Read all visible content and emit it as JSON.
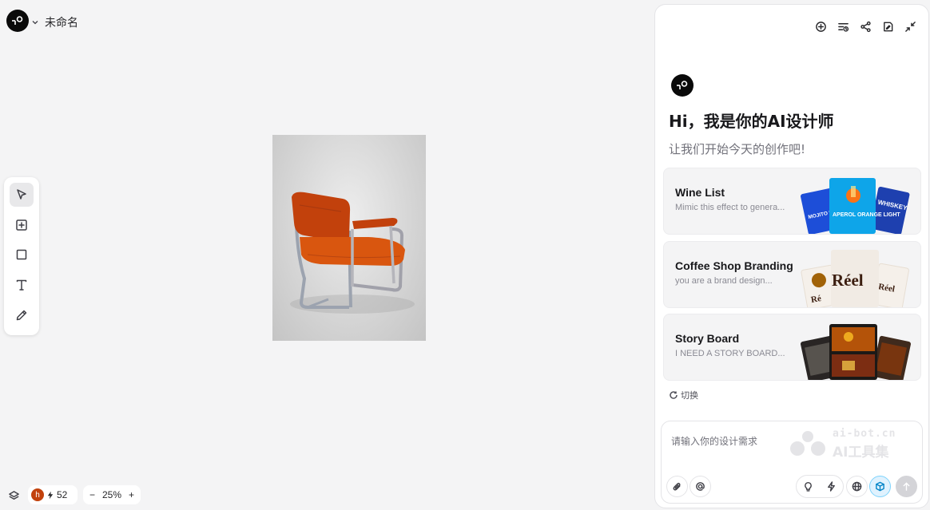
{
  "header": {
    "doc_title": "未命名"
  },
  "toolbar": {
    "tools": [
      {
        "name": "select-tool",
        "icon": "cursor-icon",
        "active": true
      },
      {
        "name": "add-frame-tool",
        "icon": "plus-square-icon",
        "active": false
      },
      {
        "name": "rectangle-tool",
        "icon": "square-icon",
        "active": false
      },
      {
        "name": "text-tool",
        "icon": "text-icon",
        "active": false
      },
      {
        "name": "pen-tool",
        "icon": "pencil-icon",
        "active": false
      }
    ]
  },
  "bottom_bar": {
    "avatar_initial": "h",
    "credits": "52",
    "zoom_minus": "−",
    "zoom_level": "25%",
    "zoom_plus": "+"
  },
  "assistant": {
    "header_icons": [
      "new-chat-icon",
      "history-icon",
      "share-icon",
      "note-icon",
      "collapse-icon"
    ],
    "greeting": "Hi，我是你的AI设计师",
    "subgreeting": "让我们开始今天的创作吧!",
    "templates": [
      {
        "title": "Wine List",
        "desc": "Mimic this effect to genera..."
      },
      {
        "title": "Coffee Shop Branding",
        "desc": "you are a brand design..."
      },
      {
        "title": "Story Board",
        "desc": "I NEED A STORY BOARD..."
      }
    ],
    "wine_art": {
      "left": "MOJITO MINT FRESH",
      "center": "APEROL ORANGE LIGHT",
      "right": "WHISKEY"
    },
    "coffee_art": {
      "main": "Réel",
      "side": "Réel",
      "left": "Ré"
    },
    "switch_label": "切换",
    "input_placeholder": "请输入你的设计需求",
    "watermark": {
      "line1": "ai-bot.cn",
      "line2": "AI工具集"
    }
  },
  "colors": {
    "accent": "#0ea5e9",
    "chair": "#c2410c",
    "avatar": "#c2410c",
    "panel_bg": "#ffffff",
    "canvas_bg": "#f4f4f5"
  }
}
